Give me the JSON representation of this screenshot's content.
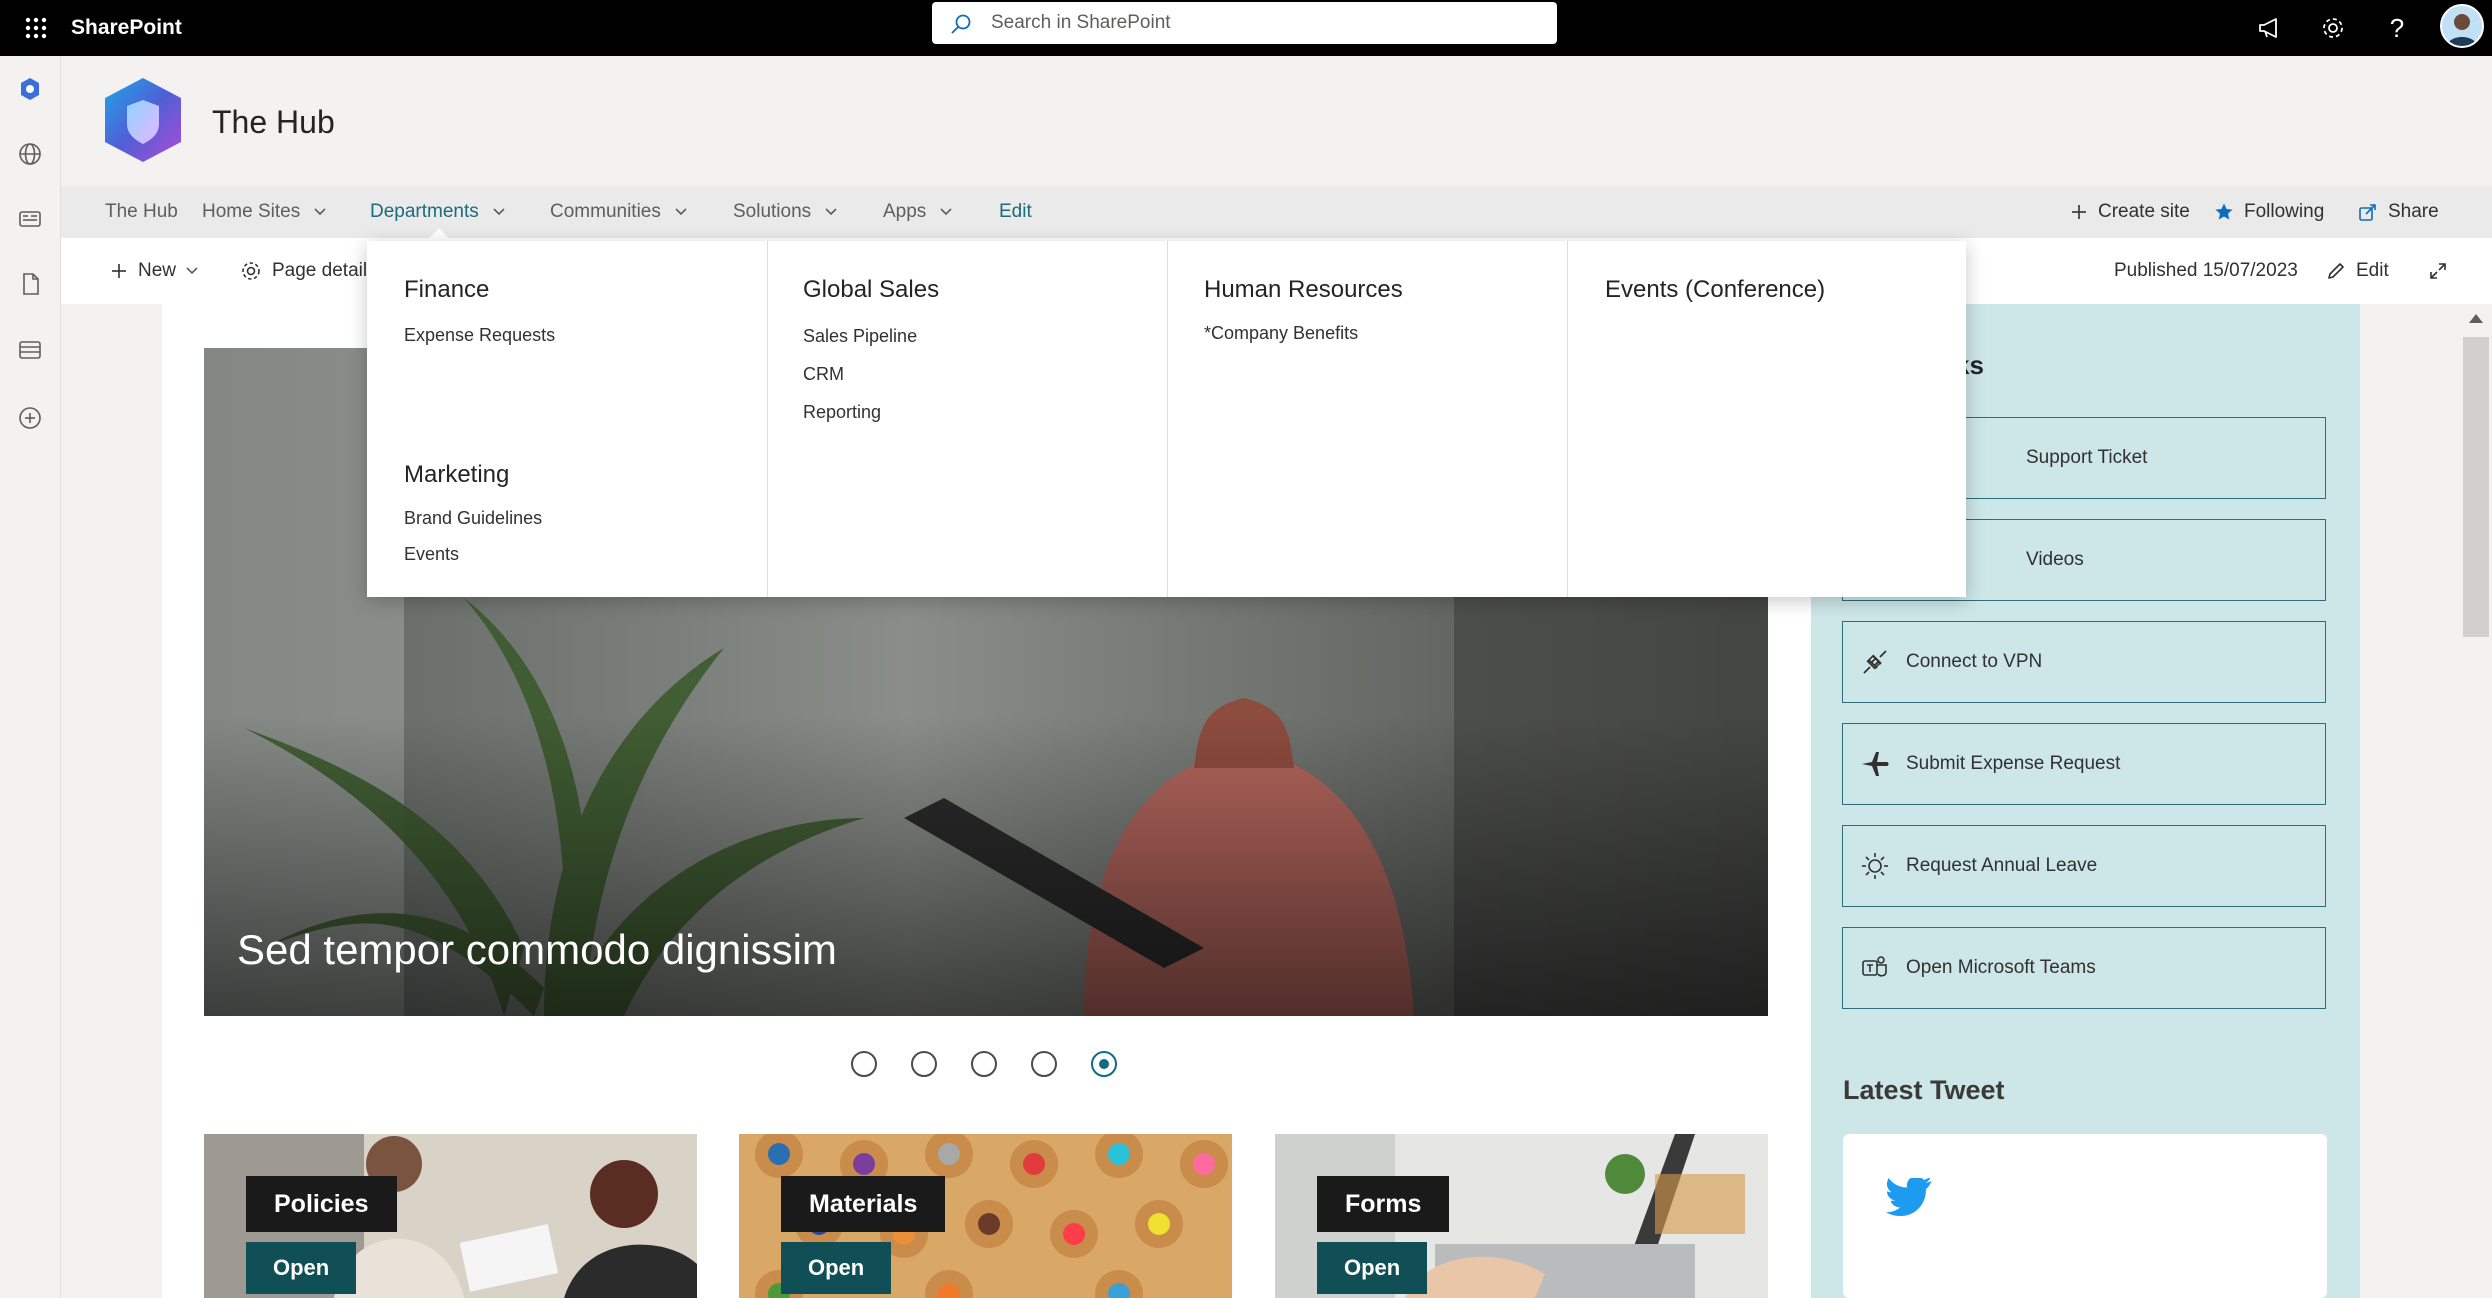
{
  "suite_bar": {
    "app_name": "SharePoint",
    "search_placeholder": "Search in SharePoint",
    "icons": [
      "app-launcher-icon",
      "megaphone-icon",
      "settings-gear-icon",
      "help-icon",
      "user-avatar"
    ]
  },
  "app_bar": {
    "icons": [
      "sharepoint-home-icon",
      "globe-icon",
      "news-icon",
      "file-icon",
      "list-icon",
      "create-icon"
    ]
  },
  "site": {
    "title": "The Hub"
  },
  "nav": {
    "items": [
      {
        "label": "The Hub",
        "has_dropdown": false
      },
      {
        "label": "Home Sites",
        "has_dropdown": true
      },
      {
        "label": "Departments",
        "has_dropdown": true,
        "active": true
      },
      {
        "label": "Communities",
        "has_dropdown": true
      },
      {
        "label": "Solutions",
        "has_dropdown": true
      },
      {
        "label": "Apps",
        "has_dropdown": true
      }
    ],
    "edit_label": "Edit",
    "actions": {
      "create_site": "Create site",
      "following": "Following",
      "share": "Share"
    }
  },
  "command_bar": {
    "new_label": "New",
    "page_details_label": "Page details",
    "published": "Published 15/07/2023",
    "edit_label": "Edit"
  },
  "mega_menu": {
    "columns": [
      {
        "groups": [
          {
            "heading": "Finance",
            "links": [
              "Expense Requests"
            ]
          },
          {
            "heading": "Marketing",
            "links": [
              "Brand Guidelines",
              "Events"
            ]
          }
        ]
      },
      {
        "groups": [
          {
            "heading": "Global Sales",
            "links": [
              "Sales Pipeline",
              "CRM",
              "Reporting"
            ]
          }
        ]
      },
      {
        "groups": [
          {
            "heading": "Human Resources",
            "links": [
              "*Company Benefits"
            ]
          }
        ]
      },
      {
        "groups": [
          {
            "heading": "Events (Conference)",
            "links": []
          }
        ]
      }
    ]
  },
  "hero": {
    "title": "Sed tempor commodo dignissim",
    "slides": 5,
    "selected_slide": 5
  },
  "cards": [
    {
      "label": "Policies",
      "button": "Open"
    },
    {
      "label": "Materials",
      "button": "Open"
    },
    {
      "label": "Forms",
      "button": "Open"
    }
  ],
  "quick_links": {
    "title_visible": "ks",
    "items": [
      {
        "label": "Support Ticket",
        "icon": "ticket-icon"
      },
      {
        "label": "Videos",
        "icon": "video-icon"
      },
      {
        "label": "Connect to VPN",
        "icon": "plug-icon"
      },
      {
        "label": "Submit Expense Request",
        "icon": "airplane-icon"
      },
      {
        "label": "Request Annual Leave",
        "icon": "sun-icon"
      },
      {
        "label": "Open Microsoft Teams",
        "icon": "teams-icon"
      }
    ]
  },
  "latest_tweet": {
    "title": "Latest Tweet",
    "icon": "twitter-bird-icon"
  },
  "colors": {
    "accent": "#0f6d7d",
    "nav_active": "#1c6b7a",
    "quick_links_bg": "#cde6e8",
    "card_button": "#0f4f55"
  }
}
